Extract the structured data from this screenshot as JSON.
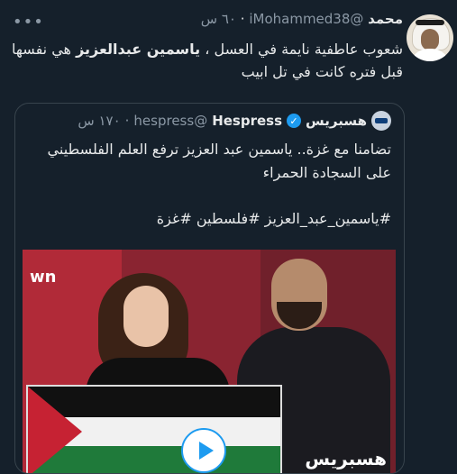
{
  "tweet": {
    "name": "محمد",
    "handle": "@iMohammed38",
    "time": "٦٠ س",
    "text_before": "شعوب عاطفية نايمة في العسل ، ",
    "mention": "ياسمين عبدالعزيز",
    "text_after": " هي نفسها",
    "text_line2": "قبل فتره كانت في تل ابيب",
    "more_icon": "more-horizontal-icon"
  },
  "quote": {
    "avatar_label": "هسبريس",
    "name_ar": "هسبريس",
    "name_en": "Hespress",
    "handle": "@hespress",
    "time": "١٧٠ س",
    "text": "تضامنا مع غزة.. ياسمين عبد العزيز ترفع العلم الفلسطيني على السجادة الحمراء",
    "hashtags": "#ياسمين_عبد_العزيز #فلسطين #غزة",
    "media": {
      "logo_text": "wn",
      "brand_text": "هسبريس",
      "play_icon": "play-icon"
    }
  },
  "colors": {
    "background": "#15202b",
    "text": "#e7e9ea",
    "secondary": "#8b98a5",
    "accent": "#1d9bf0",
    "border": "#38444d"
  }
}
